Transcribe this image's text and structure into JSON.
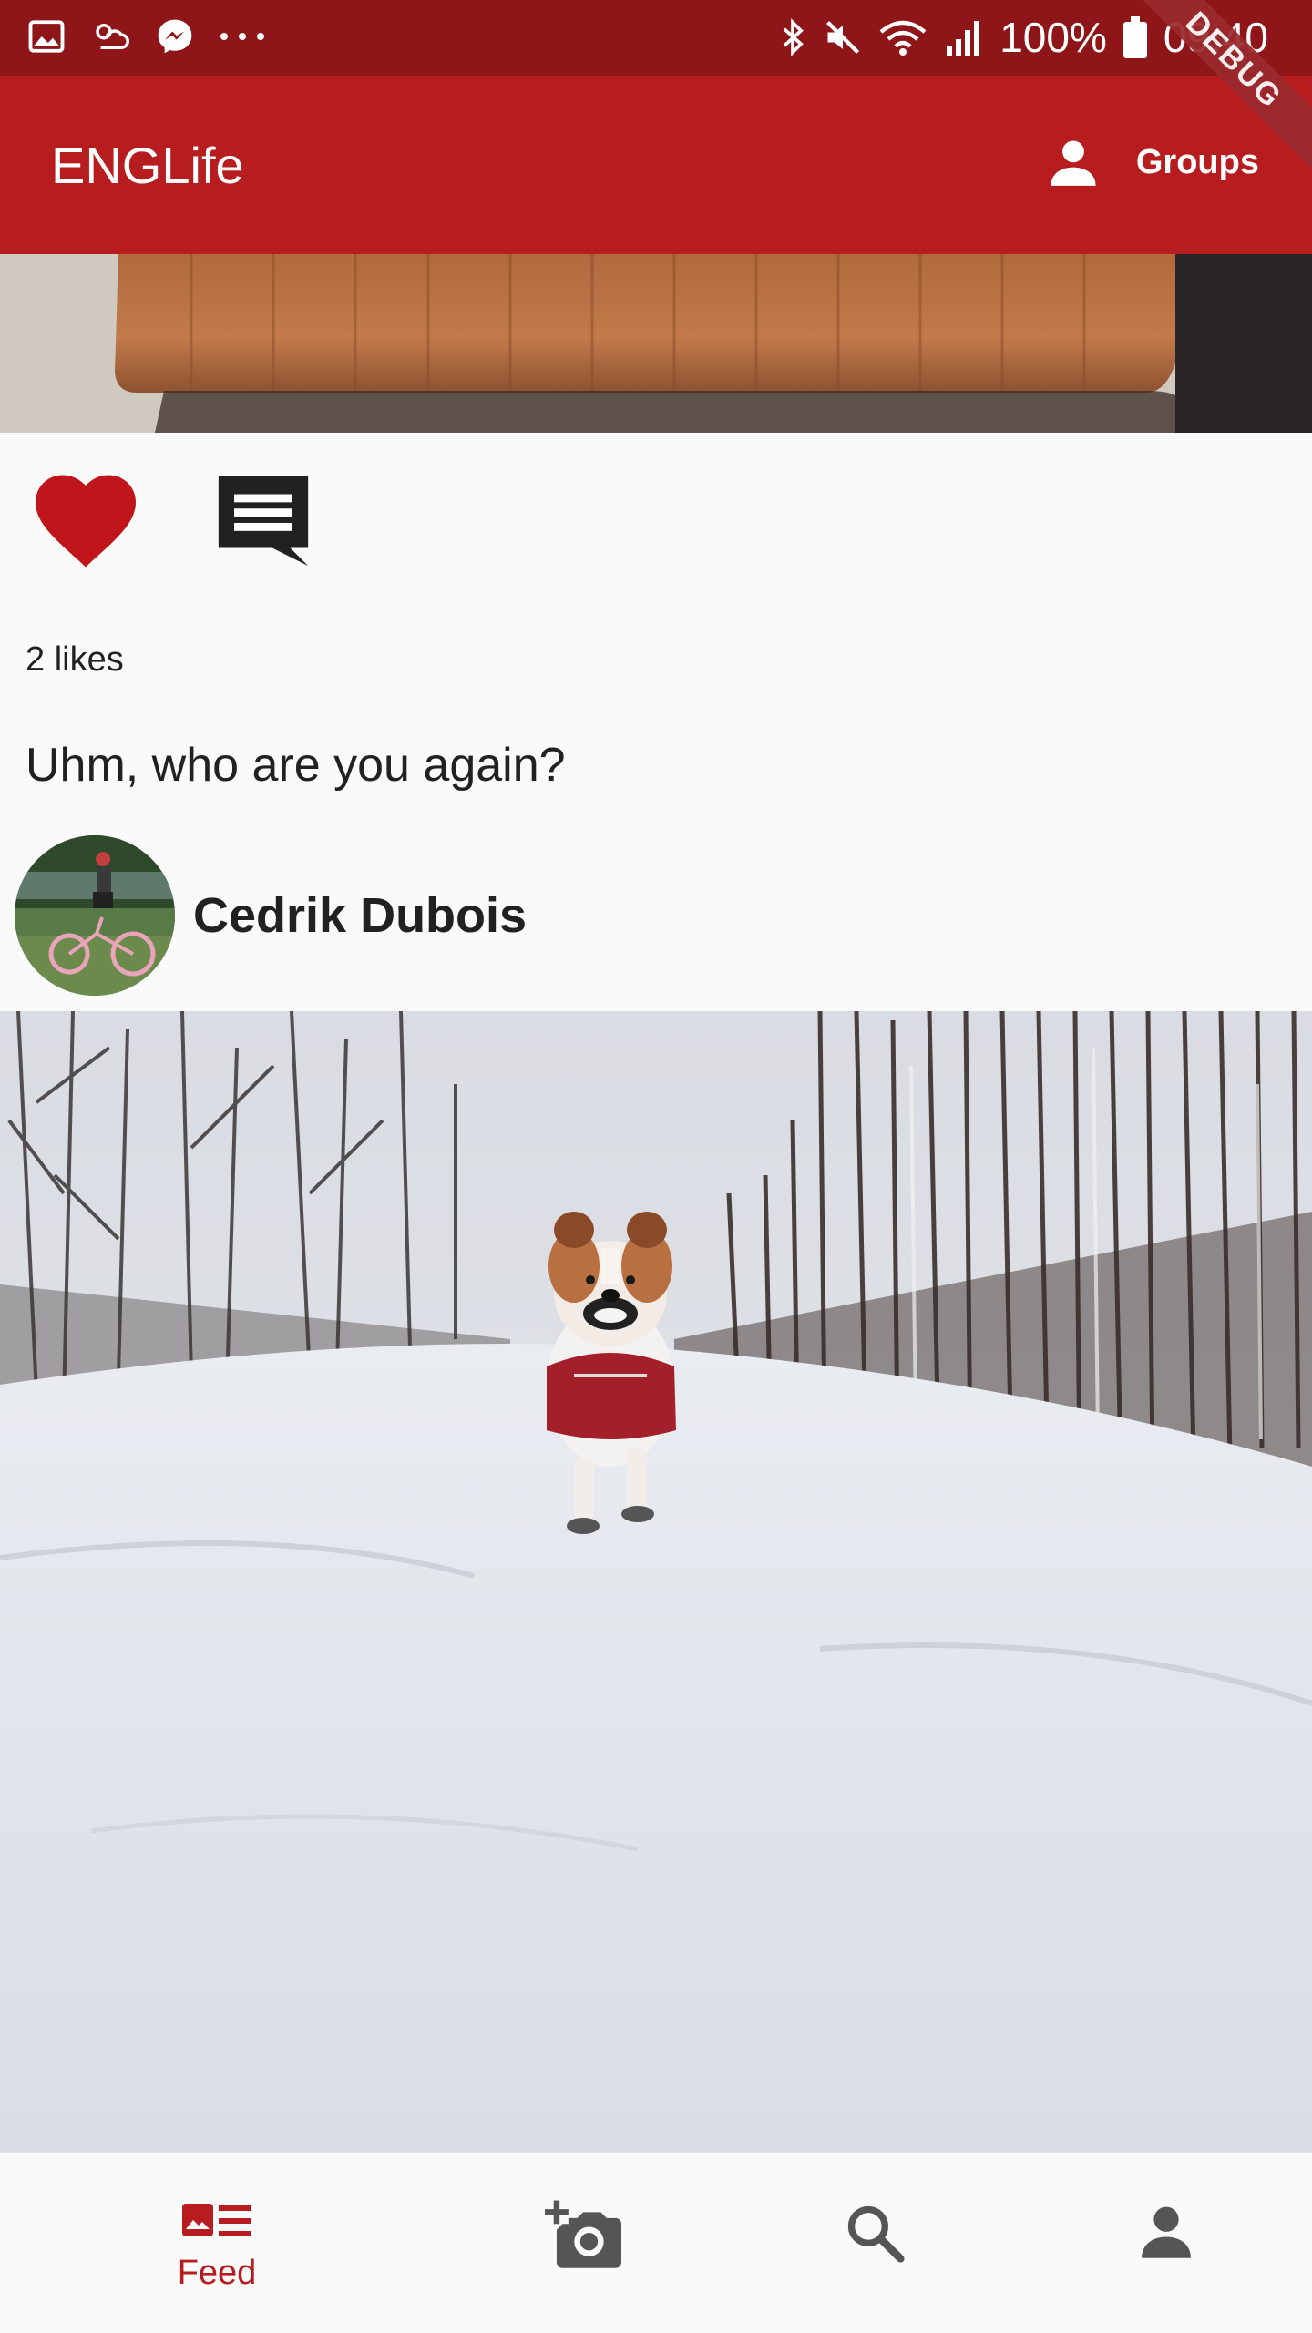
{
  "status_bar": {
    "battery": "100%",
    "time": "09:40",
    "icons": [
      "gallery-icon",
      "weather-icon",
      "messenger-icon",
      "more-dots-icon",
      "bluetooth-icon",
      "mute-icon",
      "wifi-icon",
      "signal-icon",
      "battery-icon"
    ]
  },
  "app_bar": {
    "title": "ENGLife",
    "groups_label": "Groups",
    "debug_banner": "DEBUG"
  },
  "post": {
    "likes_text": "2 likes",
    "caption": "Uhm, who are you again?",
    "author_name": "Cedrik Dubois",
    "liked": true
  },
  "bottom_nav": {
    "items": [
      {
        "name": "feed",
        "label": "Feed",
        "icon": "feed-icon",
        "active": true
      },
      {
        "name": "upload",
        "label": "",
        "icon": "add-photo-icon",
        "active": false
      },
      {
        "name": "search",
        "label": "",
        "icon": "search-icon",
        "active": false
      },
      {
        "name": "profile",
        "label": "",
        "icon": "person-icon",
        "active": false
      }
    ]
  },
  "colors": {
    "status_bar": "#8e1518",
    "app_bar": "#b71c1f",
    "heart": "#c0151b",
    "nav_active": "#b71c1f",
    "nav_inactive": "#555555"
  }
}
